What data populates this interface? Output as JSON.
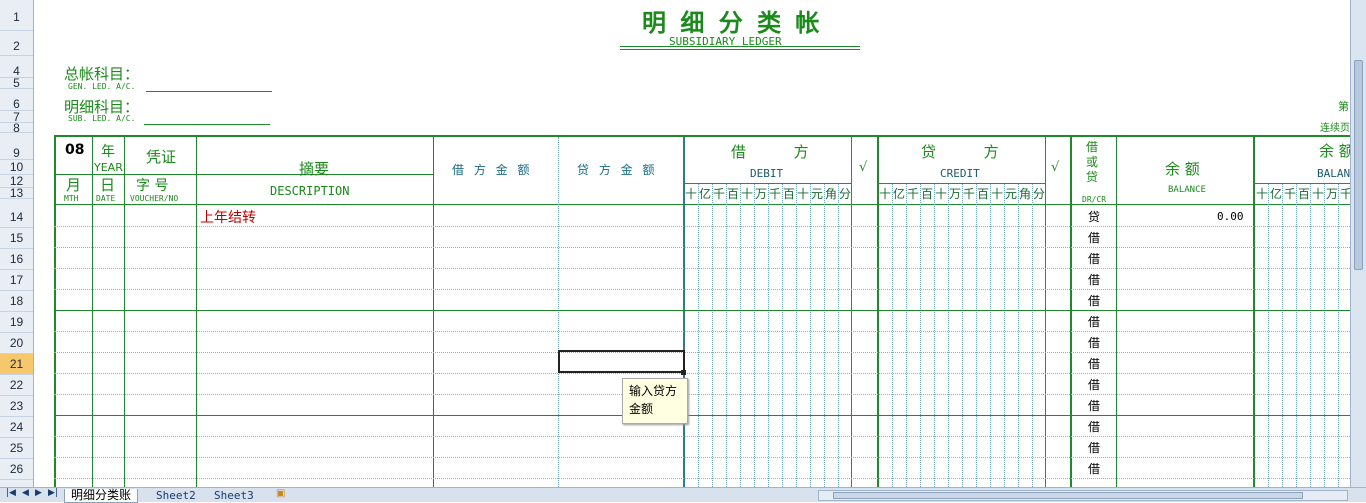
{
  "row_numbers": [
    "1",
    "2",
    "4",
    "5",
    "6",
    "7",
    "8",
    "9",
    "10",
    "12",
    "13",
    "14",
    "15",
    "16",
    "17",
    "18",
    "19",
    "20",
    "21",
    "22",
    "23",
    "24",
    "25",
    "26"
  ],
  "title": {
    "cn": "明 细 分 类 帐",
    "en": "SUBSIDIARY  LEDGER"
  },
  "gen_ledger": {
    "cn": "总帐科目：",
    "en": "GEN. LED. A/C."
  },
  "sub_ledger": {
    "cn": "明细科目：",
    "en": "SUB. LED. A/C."
  },
  "right_note": "连续页",
  "right_mark": "第",
  "header": {
    "month_num": "08",
    "year_cn": "年",
    "year_en": "YEAR",
    "voucher_cn": "凭证",
    "month_cn": "月",
    "month_en": "MTH",
    "day_cn": "日",
    "day_en": "DATE",
    "voucher_word": "字  号",
    "voucher_en": "VOUCHER/NO",
    "desc_cn": "摘要",
    "desc_en": "DESCRIPTION",
    "debit_amt": "借 方 金 额",
    "credit_amt": "贷 方 金 额",
    "debit_cn": "借          方",
    "debit_en": "DEBIT",
    "check": "√",
    "credit_cn": "贷          方",
    "credit_en": "CREDIT",
    "drcr_cn": "借\n或\n贷",
    "drcr_en": "DR/CR",
    "balance_cn": "余 额",
    "balance_en": "BALANCE",
    "balance2_cn": "余 额",
    "balance2_en": "BALAN"
  },
  "digit_units": [
    "十",
    "亿",
    "千",
    "百",
    "十",
    "万",
    "千",
    "百",
    "十",
    "元",
    "角",
    "分"
  ],
  "rows": [
    {
      "row": "14",
      "desc": "上年结转",
      "drcr": "贷",
      "balance": "0.00"
    },
    {
      "row": "15",
      "desc": "",
      "drcr": "借",
      "balance": ""
    },
    {
      "row": "16",
      "desc": "",
      "drcr": "借",
      "balance": ""
    },
    {
      "row": "17",
      "desc": "",
      "drcr": "借",
      "balance": ""
    },
    {
      "row": "18",
      "desc": "",
      "drcr": "借",
      "balance": ""
    },
    {
      "row": "19",
      "desc": "",
      "drcr": "借",
      "balance": ""
    },
    {
      "row": "20",
      "desc": "",
      "drcr": "借",
      "balance": ""
    },
    {
      "row": "21",
      "desc": "",
      "drcr": "借",
      "balance": ""
    },
    {
      "row": "22",
      "desc": "",
      "drcr": "借",
      "balance": ""
    },
    {
      "row": "23",
      "desc": "",
      "drcr": "借",
      "balance": ""
    },
    {
      "row": "24",
      "desc": "",
      "drcr": "借",
      "balance": ""
    },
    {
      "row": "25",
      "desc": "",
      "drcr": "借",
      "balance": ""
    },
    {
      "row": "26",
      "desc": "",
      "drcr": "借",
      "balance": ""
    }
  ],
  "tooltip": {
    "line1": "输入贷方",
    "line2": "金额"
  },
  "sheet_tabs": [
    "明细分类账",
    "Sheet2",
    "Sheet3"
  ],
  "selected_row": "21",
  "colors": {
    "green": "#1f8a2a",
    "teal": "#2b7a99",
    "red": "#c00000",
    "row_header_bg": "#e9eef5",
    "selected_row_bg": "#f7c86b",
    "tooltip_bg": "#ffffe1"
  }
}
